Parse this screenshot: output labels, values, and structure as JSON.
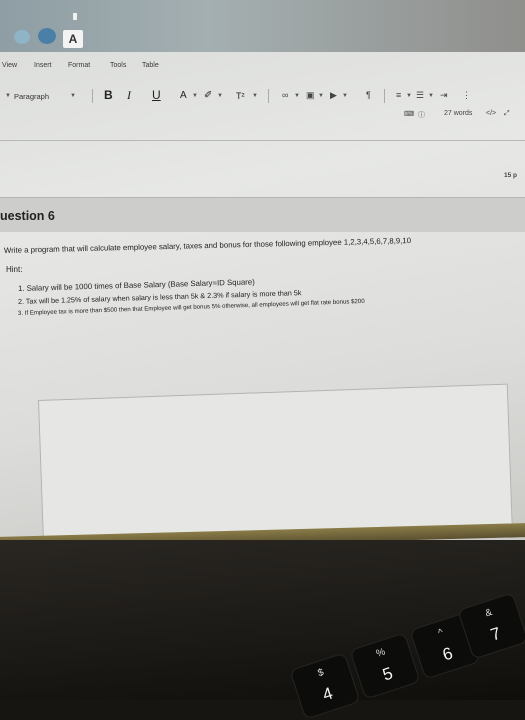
{
  "toolbar_top": {
    "user_initial": "A"
  },
  "menu": {
    "items": [
      "View",
      "Insert",
      "Format",
      "Tools",
      "Table"
    ]
  },
  "format_toolbar": {
    "paragraph_label": "Paragraph",
    "bold": "B",
    "italic": "I",
    "underline": "U",
    "text_color": "A",
    "highlight": "✐",
    "superscript": "T²"
  },
  "status": {
    "word_count": "27 words",
    "code_view": "</>"
  },
  "question": {
    "points": "15 p",
    "title": "uestion 6",
    "prompt": "Write a program that will calculate employee salary, taxes and bonus for those following employee 1,2,3,4,5,6,7,8,9,10",
    "hint_label": "Hint:",
    "hints": [
      "1. Salary will be 1000 times of Base Salary (Base Salary=ID Square)",
      "2. Tax will be 1.25% of salary when salary is less than 5k & 2.3% if salary is more than 5k",
      "3. If Employee tax is more than $500 then that Employee will get bonus 5% otherwise, all employees will get flat rate bonus $200"
    ]
  },
  "keyboard": {
    "keys": [
      {
        "top": "$",
        "bottom": "4"
      },
      {
        "top": "%",
        "bottom": "5"
      },
      {
        "top": "^",
        "bottom": "6"
      },
      {
        "top": "&",
        "bottom": "7"
      }
    ]
  }
}
